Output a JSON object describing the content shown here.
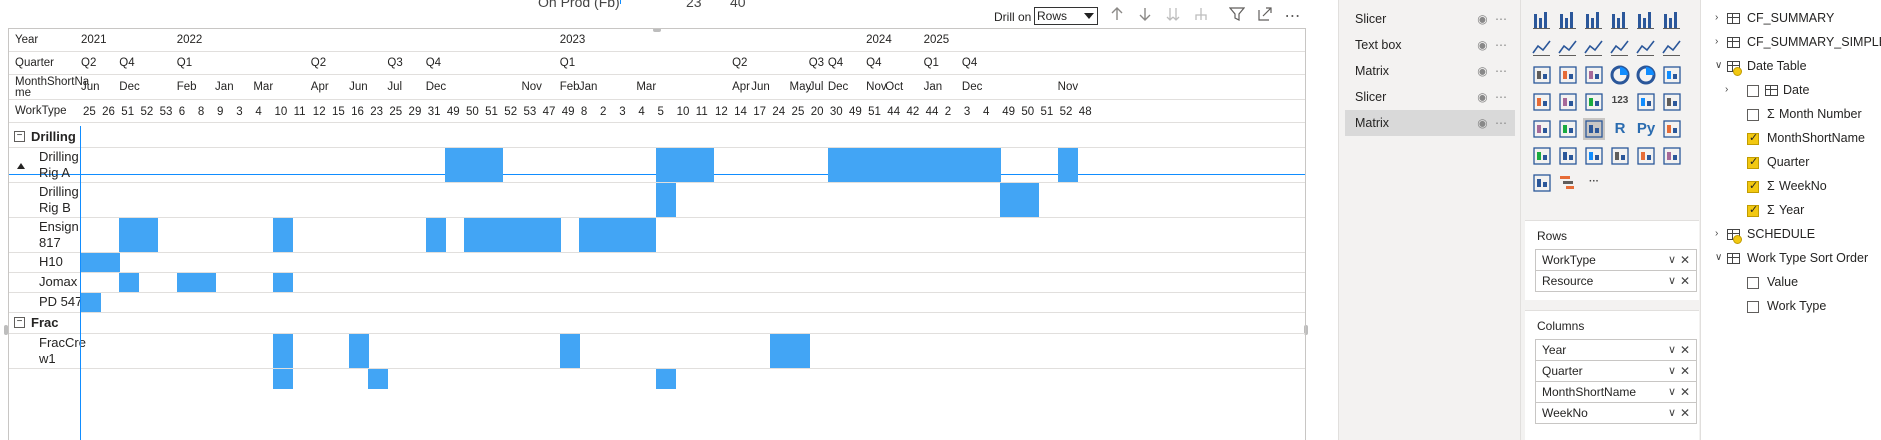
{
  "top_fragment": {
    "label": "On Prod (Fb)",
    "v1": "23",
    "v2": "40"
  },
  "toolbar": {
    "drill_label": "Drill on",
    "drill_value": "Rows",
    "icons": [
      "arrow-up-icon",
      "arrow-down-icon",
      "double-down-icon",
      "expand-hierarchy-icon",
      "filter-icon",
      "focus-mode-icon",
      "more-options-icon"
    ]
  },
  "matrix": {
    "header_labels": [
      "Year",
      "Quarter",
      "MonthShortName",
      "WorkType"
    ],
    "month_header_lines": [
      "MonthShortNa",
      "me"
    ],
    "years": [
      {
        "label": "2021",
        "col": 0
      },
      {
        "label": "2022",
        "col": 5
      },
      {
        "label": "2023",
        "col": 25
      },
      {
        "label": "2024",
        "col": 41
      },
      {
        "label": "2025",
        "col": 44
      }
    ],
    "quarters": [
      {
        "label": "Q2",
        "col": 0
      },
      {
        "label": "Q4",
        "col": 2
      },
      {
        "label": "Q1",
        "col": 5
      },
      {
        "label": "Q2",
        "col": 12
      },
      {
        "label": "Q3",
        "col": 16
      },
      {
        "label": "Q4",
        "col": 18
      },
      {
        "label": "Q1",
        "col": 25
      },
      {
        "label": "Q2",
        "col": 34
      },
      {
        "label": "Q3",
        "col": 38
      },
      {
        "label": "Q4",
        "col": 39
      },
      {
        "label": "Q4",
        "col": 41
      },
      {
        "label": "Q1",
        "col": 44
      },
      {
        "label": "Q4",
        "col": 46
      }
    ],
    "months": [
      {
        "label": "Jun",
        "col": 0
      },
      {
        "label": "Dec",
        "col": 2
      },
      {
        "label": "Feb",
        "col": 5
      },
      {
        "label": "Jan",
        "col": 7
      },
      {
        "label": "Mar",
        "col": 9
      },
      {
        "label": "Apr",
        "col": 12
      },
      {
        "label": "Jun",
        "col": 14
      },
      {
        "label": "Jul",
        "col": 16
      },
      {
        "label": "Dec",
        "col": 18
      },
      {
        "label": "Nov",
        "col": 23
      },
      {
        "label": "Feb",
        "col": 25
      },
      {
        "label": "Jan",
        "col": 26
      },
      {
        "label": "Mar",
        "col": 29
      },
      {
        "label": "Apr",
        "col": 34
      },
      {
        "label": "Jun",
        "col": 35
      },
      {
        "label": "May",
        "col": 37
      },
      {
        "label": "Jul",
        "col": 38
      },
      {
        "label": "Dec",
        "col": 39
      },
      {
        "label": "Nov",
        "col": 41
      },
      {
        "label": "Oct",
        "col": 42
      },
      {
        "label": "Jan",
        "col": 44
      },
      {
        "label": "Dec",
        "col": 46
      },
      {
        "label": "Nov",
        "col": 51
      }
    ],
    "weeks": [
      "25",
      "26",
      "51",
      "52",
      "53",
      "6",
      "8",
      "9",
      "3",
      "4",
      "10",
      "11",
      "12",
      "15",
      "16",
      "23",
      "25",
      "29",
      "31",
      "49",
      "50",
      "51",
      "52",
      "53",
      "47",
      "49",
      "8",
      "2",
      "3",
      "4",
      "5",
      "10",
      "11",
      "12",
      "14",
      "17",
      "24",
      "25",
      "20",
      "30",
      "49",
      "51",
      "44",
      "42",
      "44",
      "2",
      "3",
      "4",
      "49",
      "50",
      "51",
      "52",
      "48"
    ],
    "groups": [
      {
        "name": "Drilling",
        "rows": [
          {
            "lines": [
              "Drilling",
              "Rig A"
            ],
            "filled": [
              19,
              20,
              21,
              30,
              31,
              32,
              39,
              40,
              41,
              42,
              43,
              44,
              45,
              46,
              47,
              51
            ]
          },
          {
            "lines": [
              "Drilling",
              "Rig B"
            ],
            "filled": [
              30,
              48,
              49
            ]
          },
          {
            "lines": [
              "Ensign",
              "817"
            ],
            "filled": [
              2,
              3,
              10,
              18,
              20,
              21,
              22,
              23,
              24,
              26,
              27,
              28,
              29
            ]
          },
          {
            "lines": [
              "H10"
            ],
            "filled": [
              0,
              1
            ]
          },
          {
            "lines": [
              "Jomax"
            ],
            "filled": [
              2,
              5,
              6,
              10
            ]
          },
          {
            "lines": [
              "PD 547"
            ],
            "filled": [
              0
            ]
          }
        ]
      },
      {
        "name": "Frac",
        "rows": [
          {
            "lines": [
              "FracCre",
              "w1"
            ],
            "filled": [
              10,
              14,
              25,
              36,
              37
            ]
          }
        ]
      }
    ],
    "partial_row_filled": [
      10,
      15,
      30
    ]
  },
  "selection_pane": {
    "items": [
      {
        "label": "Slicer",
        "active": false
      },
      {
        "label": "Text box",
        "active": false
      },
      {
        "label": "Matrix",
        "active": false
      },
      {
        "label": "Slicer",
        "active": false
      },
      {
        "label": "Matrix",
        "active": true
      }
    ],
    "item_icons": "◉ ⋯"
  },
  "viz_pane": {
    "icon_rows": [
      [
        "stacked-bar-icon",
        "stacked-column-icon",
        "clustered-bar-icon",
        "clustered-column-icon",
        "100pct-bar-icon",
        "100pct-column-icon"
      ],
      [
        "line-chart-icon",
        "area-chart-icon",
        "stacked-area-icon",
        "line-column-icon",
        "line-clustered-icon",
        "ribbon-chart-icon"
      ],
      [
        "waterfall-icon",
        "funnel-icon",
        "scatter-icon",
        "pie-icon",
        "donut-icon",
        "treemap-icon"
      ],
      [
        "map-icon",
        "filled-map-icon",
        "gauge-icon",
        "card-icon",
        "multirow-card-icon",
        "kpi-icon"
      ],
      [
        "slicer-icon",
        "table-icon",
        "matrix-icon",
        "r-visual-icon",
        "python-visual-icon",
        "key-influencers-icon"
      ],
      [
        "decomposition-tree-icon",
        "qa-icon",
        "smart-narrative-icon",
        "paginated-icon",
        "power-apps-icon",
        "power-automate-icon"
      ],
      [
        "chevron-visual-icon",
        "gantt-icon",
        "more-visuals-icon"
      ]
    ],
    "r_glyph": "R",
    "py_glyph": "Py",
    "card_glyph": "123",
    "more_glyph": "···",
    "rows_title": "Rows",
    "rows": [
      "WorkType",
      "Resource"
    ],
    "columns_title": "Columns",
    "columns": [
      "Year",
      "Quarter",
      "MonthShortName",
      "WeekNo"
    ]
  },
  "fields_pane": {
    "tree": [
      {
        "label": "CF_SUMMARY",
        "type": "table",
        "expanded": false,
        "indent": 0
      },
      {
        "label": "CF_SUMMARY_SIMPLE",
        "type": "table",
        "expanded": false,
        "indent": 0
      },
      {
        "label": "Date Table",
        "type": "table",
        "expanded": true,
        "indent": 0,
        "badge": true
      },
      {
        "label": "Date",
        "type": "hierarchy",
        "expanded": false,
        "indent": 1,
        "checked": false
      },
      {
        "label": "Month Number",
        "type": "sigma",
        "indent": 1,
        "checked": false
      },
      {
        "label": "MonthShortName",
        "type": "field",
        "indent": 1,
        "checked": true
      },
      {
        "label": "Quarter",
        "type": "field",
        "indent": 1,
        "checked": true
      },
      {
        "label": "WeekNo",
        "type": "sigma",
        "indent": 1,
        "checked": true
      },
      {
        "label": "Year",
        "type": "sigma",
        "indent": 1,
        "checked": true
      },
      {
        "label": "SCHEDULE",
        "type": "table",
        "expanded": false,
        "indent": 0,
        "badge": true
      },
      {
        "label": "Work Type Sort Order",
        "type": "table",
        "expanded": true,
        "indent": 0
      },
      {
        "label": "Value",
        "type": "field",
        "indent": 1,
        "checked": false
      },
      {
        "label": "Work Type",
        "type": "field",
        "indent": 1,
        "checked": false
      }
    ],
    "sigma_glyph": "Σ"
  },
  "colors": {
    "fill": "#42a5f5",
    "accent": "#118dff",
    "check": "#f2c811"
  }
}
